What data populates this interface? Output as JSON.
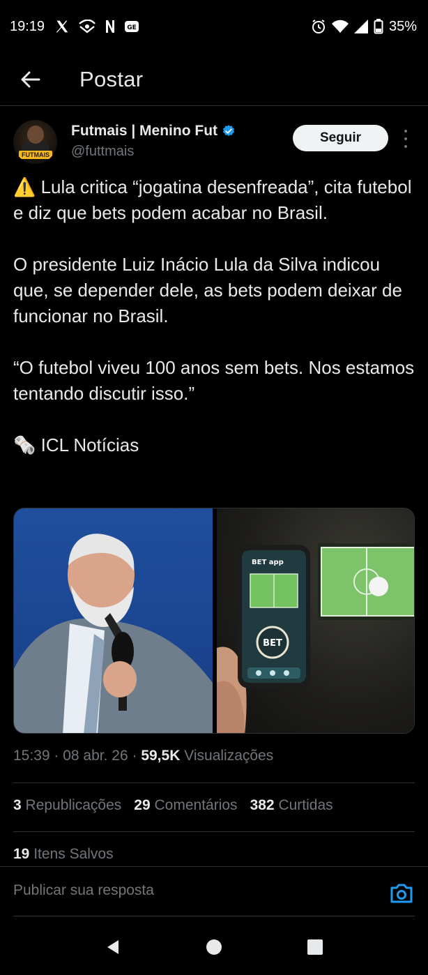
{
  "status_bar": {
    "time": "19:19",
    "battery": "35%",
    "left_icons": [
      "x-icon",
      "notification-icon",
      "n-icon",
      "ge-icon"
    ],
    "right_icons": [
      "alarm-icon",
      "wifi-icon",
      "signal-icon",
      "battery-icon"
    ]
  },
  "header": {
    "title": "Postar"
  },
  "author": {
    "name": "Futmais | Menino Fut",
    "handle": "@futtmais",
    "verified": true,
    "avatar_logo": "FUTMAIS",
    "follow_label": "Seguir"
  },
  "tweet": {
    "paragraphs": [
      "⚠️ Lula critica “jogatina desenfreada”, cita futebol e diz que bets podem acabar no Brasil.",
      "O presidente Luiz Inácio Lula da Silva indicou que, se depender dele, as bets podem deixar de funcionar no Brasil.",
      "“O futebol viveu 100 anos sem bets. Nos estamos tentando discutir isso.”",
      "🗞️ ICL Notícias"
    ],
    "phone_app_label": "BET app",
    "phone_button_label": "BET"
  },
  "meta": {
    "time": "15:39",
    "date": "08 abr. 26",
    "views_count": "59,5K",
    "views_label": "Visualizações"
  },
  "stats": {
    "reposts_count": "3",
    "reposts_label": "Republicações",
    "comments_count": "29",
    "comments_label": "Comentários",
    "likes_count": "382",
    "likes_label": "Curtidas",
    "saved_count": "19",
    "saved_label": "Itens Salvos"
  },
  "reply": {
    "placeholder": "Publicar sua resposta"
  },
  "colors": {
    "background": "#000000",
    "text": "#e7e9ea",
    "muted": "#71767b",
    "accent": "#1d9bf0",
    "divider": "#2f3336"
  }
}
